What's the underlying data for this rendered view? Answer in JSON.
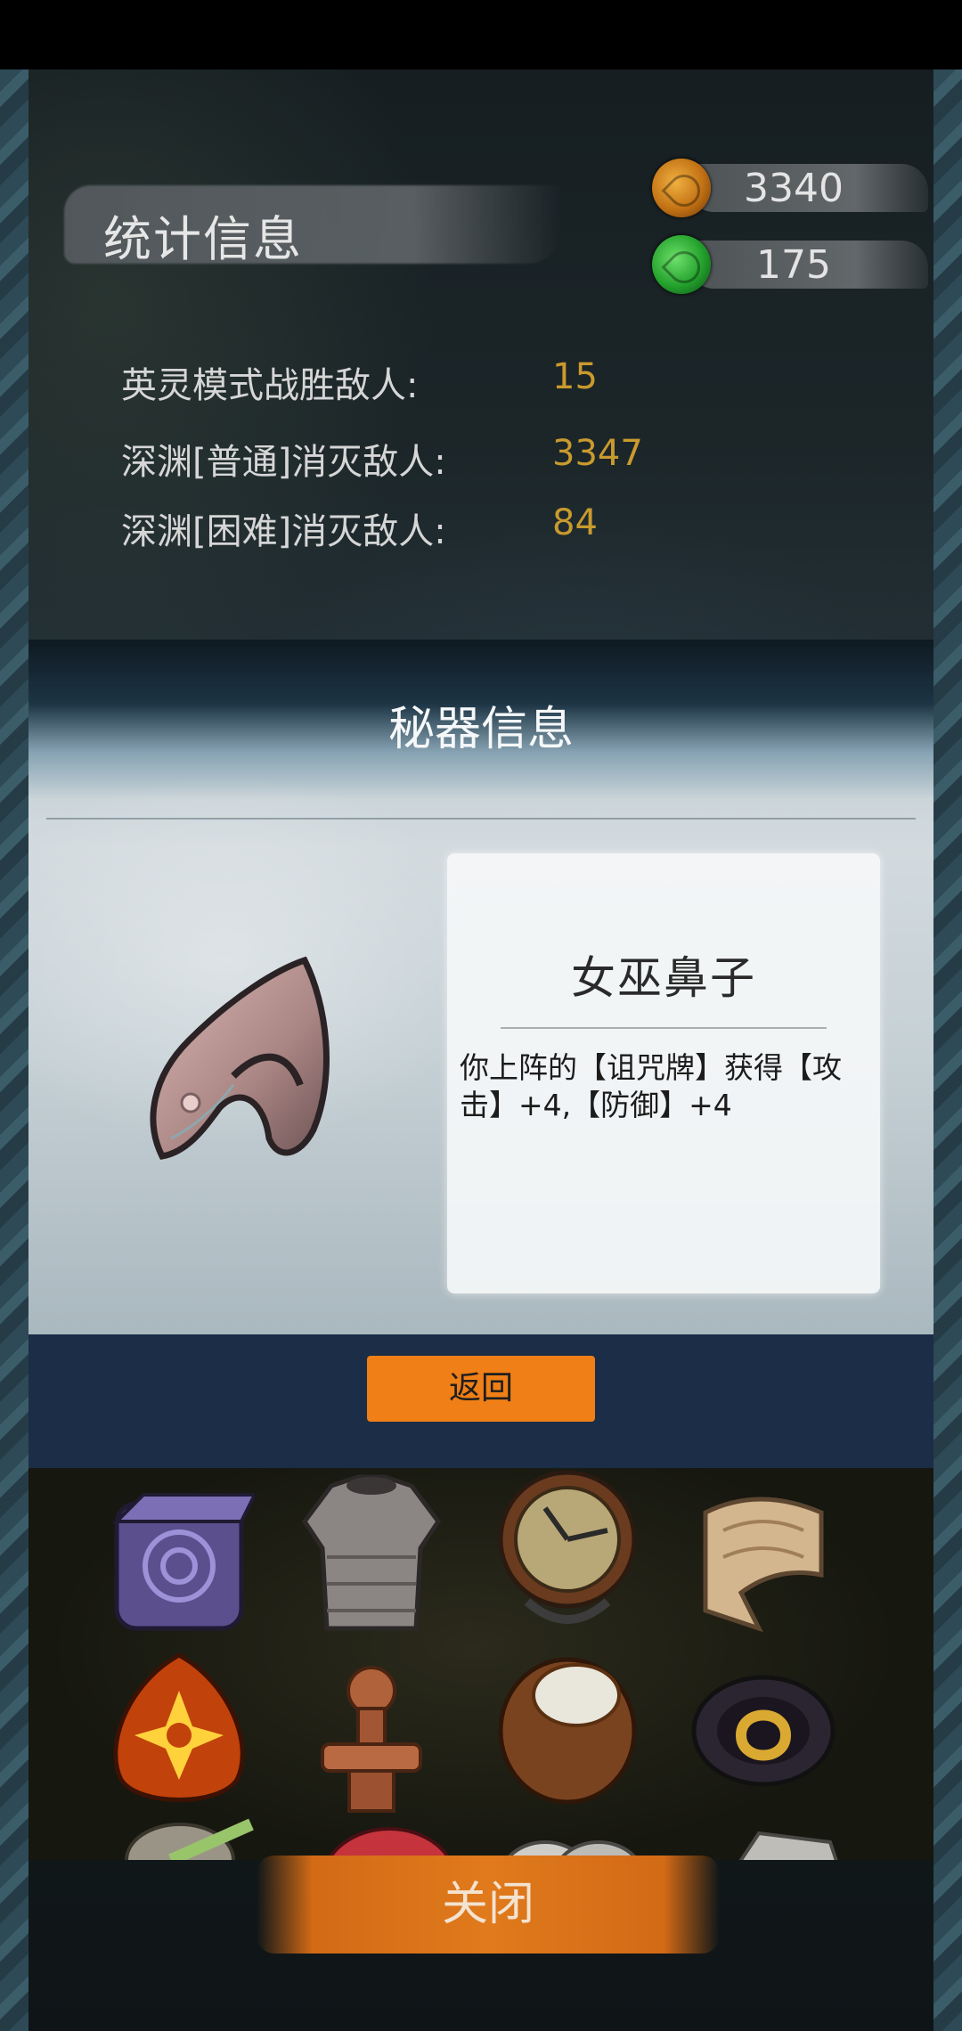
{
  "stats": {
    "title": "统计信息",
    "currency": [
      {
        "name": "orange-gem",
        "value": "3340"
      },
      {
        "name": "green-gem",
        "value": "175"
      }
    ],
    "rows": [
      {
        "label": "英灵模式战胜敌人:",
        "value": "15"
      },
      {
        "label": "深渊[普通]消灭敌人:",
        "value": "3347"
      },
      {
        "label": "深渊[困难]消灭敌人:",
        "value": "84"
      }
    ]
  },
  "relic_dialog": {
    "title": "秘器信息",
    "icon": "witch-nose-icon",
    "name": "女巫鼻子",
    "description": "你上阵的【诅咒牌】获得【攻击】+4,【防御】+4",
    "return_label": "返回"
  },
  "relic_grid": {
    "items": [
      "rune-dice-icon",
      "chainmail-armor-icon",
      "clockwork-compass-icon",
      "bandage-scroll-icon",
      "fire-rune-stone-icon",
      "wooden-totem-icon",
      "coconut-icon",
      "gold-knot-belt-icon",
      "herb-bundle-icon",
      "red-shell-icon",
      "grey-stones-icon",
      "rock-icon"
    ]
  },
  "close_label": "关闭",
  "colors": {
    "stat_value": "#c99a2e",
    "return_button": "#ef7f16",
    "close_button": "#e07a1c",
    "dialog_band": "#1b2d47"
  }
}
